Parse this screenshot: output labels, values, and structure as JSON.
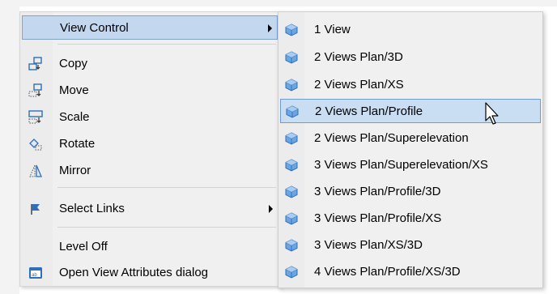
{
  "menu": {
    "items": [
      {
        "label": "View Control",
        "icon": "none",
        "submenu": true,
        "highlighted": true
      },
      {
        "label": "Copy",
        "icon": "copy-icon"
      },
      {
        "label": "Move",
        "icon": "move-icon"
      },
      {
        "label": "Scale",
        "icon": "scale-icon"
      },
      {
        "label": "Rotate",
        "icon": "rotate-icon"
      },
      {
        "label": "Mirror",
        "icon": "mirror-icon"
      },
      {
        "label": "Select Links",
        "icon": "select-links-icon",
        "submenu": true
      },
      {
        "label": "Level Off",
        "icon": "none"
      },
      {
        "label": "Open View Attributes dialog",
        "icon": "view-attributes-icon"
      }
    ]
  },
  "submenu": {
    "items": [
      {
        "label": "1 View"
      },
      {
        "label": "2 Views Plan/3D"
      },
      {
        "label": "2 Views Plan/XS"
      },
      {
        "label": "2 Views Plan/Profile",
        "highlighted": true
      },
      {
        "label": "2 Views Plan/Superelevation"
      },
      {
        "label": "3 Views Plan/Superelevation/XS"
      },
      {
        "label": "3 Views Plan/Profile/3D"
      },
      {
        "label": "3 Views Plan/Profile/XS"
      },
      {
        "label": "3 Views Plan/XS/3D"
      },
      {
        "label": "4 Views Plan/Profile/XS/3D"
      }
    ],
    "item_icon": "view-cube-icon"
  },
  "colors": {
    "menu_bg": "#f0f0f0",
    "highlight_bg": "#c9ddf3",
    "highlight_border": "#6f9bd0",
    "icon_blue": "#2f6fba"
  }
}
